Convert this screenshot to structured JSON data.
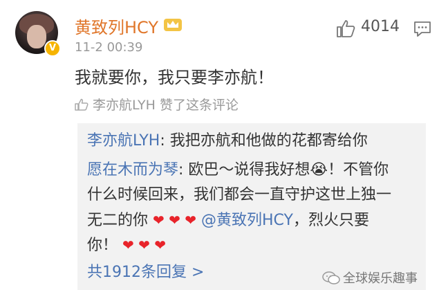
{
  "comment": {
    "username": "黄致列HCY",
    "time": "11-2 00:39",
    "like_count": "4014",
    "text": "我就要你，我只要李亦航！",
    "liked_by": "李亦航LYH 赞了这条评论"
  },
  "replies": [
    {
      "nick": "李亦航LYH",
      "text": ": 我把亦航和他做的花都寄给你"
    },
    {
      "nick": "愿在木而为琴",
      "text1": ": 欧巴～说得我好想",
      "emoji": "😭",
      "text2": "！不管你",
      "line2": "什么时候回来，我们都会一直守护这世上独一",
      "line3_pre": "无二的你",
      "hearts1": "❤ ❤ ❤",
      "mention": "@黄致列HCY",
      "line3_post": "，烈火只要",
      "line4_pre": "你！",
      "hearts2": "❤ ❤ ❤"
    }
  ],
  "more_replies": "共1912条回复 >",
  "watermark": "全球娱乐趣事",
  "colors": {
    "username": "#e0762a",
    "link": "#4a74b4",
    "vip_badge": "#f6b400",
    "heart": "#e8232a"
  }
}
